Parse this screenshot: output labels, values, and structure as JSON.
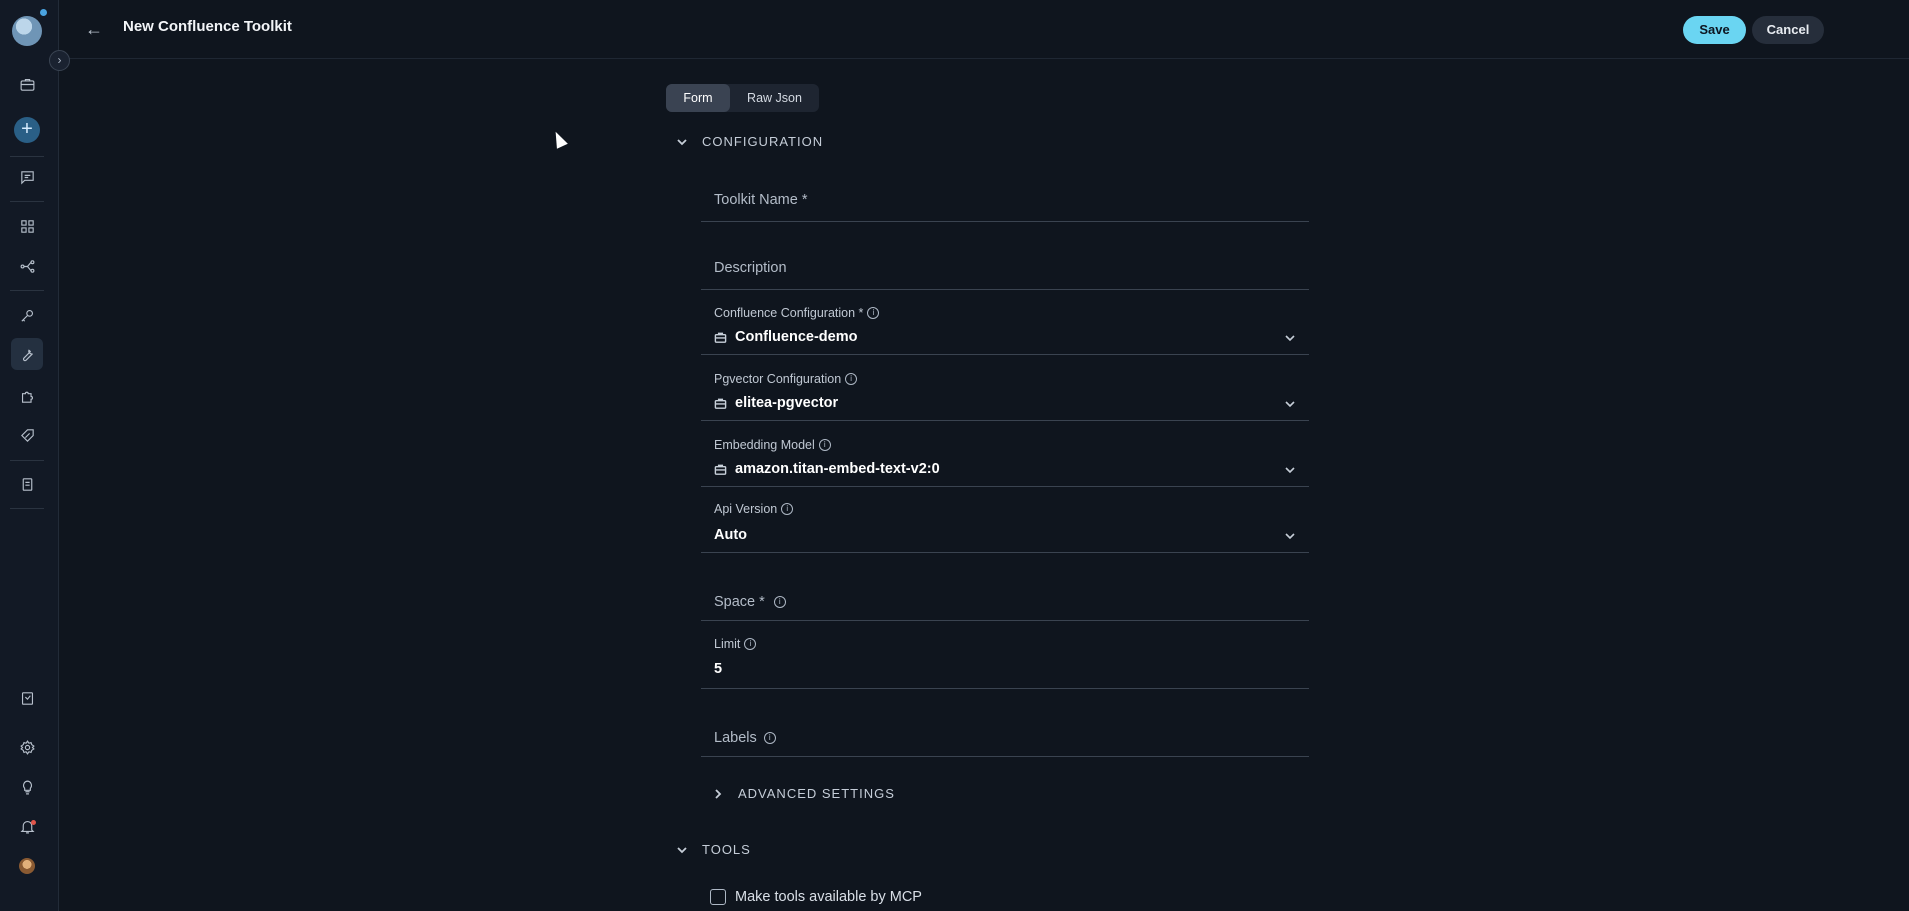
{
  "header": {
    "title": "New Confluence Toolkit",
    "save_label": "Save",
    "cancel_label": "Cancel"
  },
  "view_toggle": {
    "options": [
      "Form",
      "Raw Json"
    ],
    "selected": "Form"
  },
  "sections": {
    "configuration": "CONFIGURATION",
    "advanced": "ADVANCED SETTINGS",
    "tools": "TOOLS"
  },
  "form": {
    "toolkit_name": {
      "placeholder": "Toolkit Name *"
    },
    "description": {
      "placeholder": "Description"
    },
    "confluence_configuration": {
      "label": "Confluence Configuration *",
      "value": "Confluence-demo"
    },
    "pgvector_configuration": {
      "label": "Pgvector Configuration",
      "value": "elitea-pgvector"
    },
    "embedding_model": {
      "label": "Embedding Model",
      "value": "amazon.titan-embed-text-v2:0"
    },
    "api_version": {
      "label": "Api Version",
      "value": "Auto"
    },
    "space": {
      "placeholder": "Space *"
    },
    "limit": {
      "label": "Limit",
      "value": "5"
    },
    "labels": {
      "placeholder": "Labels"
    }
  },
  "tools": {
    "mcp_checkbox_label": "Make tools available by MCP",
    "mcp_checked": false
  },
  "colors": {
    "accent": "#6ad5f2",
    "background": "#0f151e",
    "sidebar": "#121925"
  }
}
